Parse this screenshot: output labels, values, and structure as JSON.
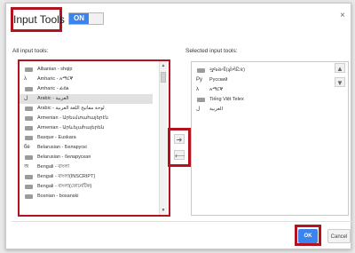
{
  "dialog": {
    "title": "Input Tools",
    "toggle_label": "ON",
    "close_icon": "×"
  },
  "left": {
    "label": "All input tools:",
    "items": [
      {
        "icon": "keyboard-icon",
        "text": "Albanian -  shqip"
      },
      {
        "icon": "lambda-icon",
        "text": "Amharic -  አማርኛ"
      },
      {
        "icon": "keyboard-icon",
        "text": "Amharic -  ፊደል"
      },
      {
        "icon": "arabic-icon",
        "text": "Arabic -  العربية",
        "selected": true
      },
      {
        "icon": "keyboard-icon",
        "text": "Arabic -  لوحة مفاتيح اللغة العربية"
      },
      {
        "icon": "keyboard-icon",
        "text": "Armenian -  Արեւմտահայերէն"
      },
      {
        "icon": "keyboard-icon",
        "text": "Armenian -  Արևելահայերեն"
      },
      {
        "icon": "keyboard-icon",
        "text": "Basque -  Euskara"
      },
      {
        "icon": "text-icon",
        "text": "Belarusian -  Беларускі"
      },
      {
        "icon": "keyboard-icon",
        "text": "Belarusian -  беларуская"
      },
      {
        "icon": "bengali-icon",
        "text": "Bengali -  বাংলা"
      },
      {
        "icon": "keyboard-icon",
        "text": "Bengali -  বাংলা(INSCRIPT)"
      },
      {
        "icon": "keyboard-icon",
        "text": "Bengali -  বাংলা(ফোনেটিক)"
      },
      {
        "icon": "keyboard-icon",
        "text": "Bosnian -  bosanski"
      }
    ]
  },
  "right": {
    "label": "Selected input tools:",
    "items": [
      {
        "icon": "keyboard-icon",
        "text": "ગુજરાતી(ફોનેટિક)"
      },
      {
        "icon": "russian-icon",
        "text": "Русский"
      },
      {
        "icon": "lambda-icon",
        "text": "አማርኛ"
      },
      {
        "icon": "keyboard-icon",
        "text": "Tiếng Việt Telex"
      },
      {
        "icon": "arabic-icon",
        "text": "العربية"
      }
    ]
  },
  "buttons": {
    "ok": "OK",
    "cancel": "Cancel"
  }
}
